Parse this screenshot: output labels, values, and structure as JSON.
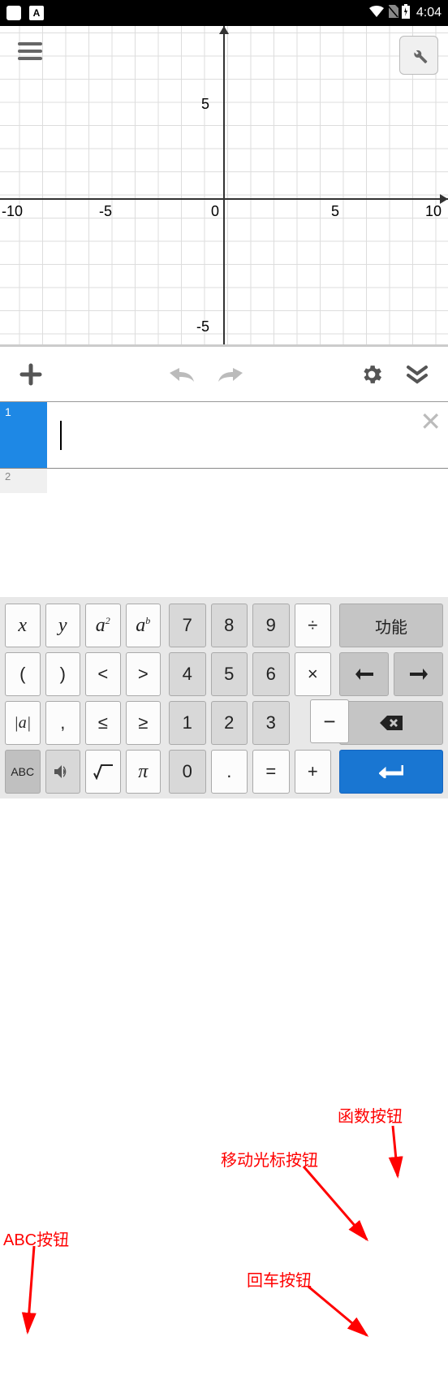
{
  "status_bar": {
    "time": "4:04",
    "wifi_icon": "wifi",
    "signal_icon": "no-sim",
    "battery_icon": "charging"
  },
  "graph": {
    "axis_labels": {
      "y_pos": "5",
      "y_neg": "-5",
      "x_pos5": "5",
      "x_pos10": "10",
      "x_neg5": "-5",
      "x_neg10": "-10",
      "origin": "0"
    }
  },
  "toolbar": {
    "add_label": "+",
    "undo_label": "↶",
    "redo_label": "↷",
    "settings_label": "⚙",
    "collapse_label": "⌄"
  },
  "input_rows": {
    "row1_num": "1",
    "row2_num": "2"
  },
  "annotations": {
    "function_button": "函数按钮",
    "cursor_button": "移动光标按钮",
    "enter_button": "回车按钮",
    "abc_button": "ABC按钮"
  },
  "keys": {
    "x": "x",
    "y": "y",
    "a2": "a",
    "a2_sup": "2",
    "ab": "a",
    "ab_sup": "b",
    "lparen": "(",
    "rparen": ")",
    "lt": "<",
    "gt": ">",
    "abs": "|a|",
    "comma": ",",
    "le": "≤",
    "ge": "≥",
    "abc": "ABC",
    "sound": "🔊",
    "sqrt": "√",
    "pi": "π",
    "7": "7",
    "8": "8",
    "9": "9",
    "div": "÷",
    "4": "4",
    "5": "5",
    "6": "6",
    "mul": "×",
    "1": "1",
    "2": "2",
    "3": "3",
    "0": "0",
    "dot": ".",
    "eq": "=",
    "plus": "+",
    "fn": "功能",
    "left": "←",
    "right": "→",
    "back": "⌫",
    "enter": "⏎"
  },
  "chart_data": {
    "type": "scatter",
    "title": "",
    "xlabel": "",
    "ylabel": "",
    "xlim": [
      -10,
      10
    ],
    "ylim": [
      -7,
      7
    ],
    "series": []
  }
}
